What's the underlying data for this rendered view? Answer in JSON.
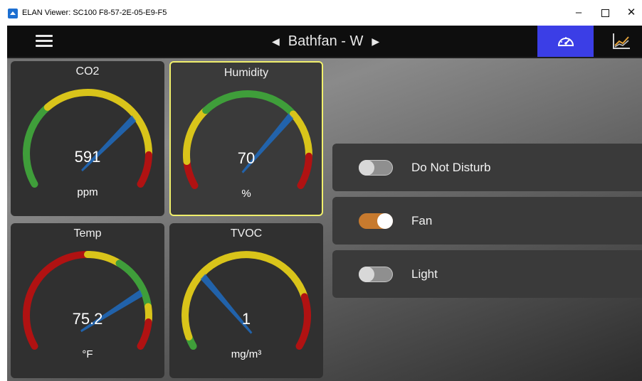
{
  "window": {
    "title": "ELAN Viewer: SC100 F8-57-2E-05-E9-F5",
    "controls": {
      "minimize": "–",
      "close": "✕"
    }
  },
  "topbar": {
    "title": "Bathfan - W",
    "prev_arrow": "◀",
    "next_arrow": "▶",
    "tabs": [
      {
        "icon": "speedometer-icon",
        "active": true
      },
      {
        "icon": "chart-icon",
        "active": false
      }
    ]
  },
  "gauges": [
    {
      "label": "CO2",
      "value": "591",
      "unit": "ppm",
      "needle_fraction": 0.72,
      "arc": "co2",
      "selected": false
    },
    {
      "label": "Humidity",
      "value": "70",
      "unit": "%",
      "needle_fraction": 0.7,
      "arc": "humidity",
      "selected": true
    },
    {
      "label": "Temp",
      "value": "75.2",
      "unit": "°F",
      "needle_fraction": 0.78,
      "arc": "temp",
      "selected": false
    },
    {
      "label": "TVOC",
      "value": "1",
      "unit": "mg/m³",
      "needle_fraction": 0.3,
      "arc": "tvoc",
      "selected": false
    }
  ],
  "colors": {
    "accent_tab": "#3b3ee6",
    "selected_border": "#f0ef6c",
    "toggle_on": "#c77a2e",
    "green": "#3f9e3a",
    "yellow": "#d9c41a",
    "red": "#b01212",
    "needle": "#1f6bc0"
  },
  "controls": [
    {
      "label": "Do Not Disturb",
      "on": false
    },
    {
      "label": "Fan",
      "on": true
    },
    {
      "label": "Light",
      "on": false
    }
  ]
}
